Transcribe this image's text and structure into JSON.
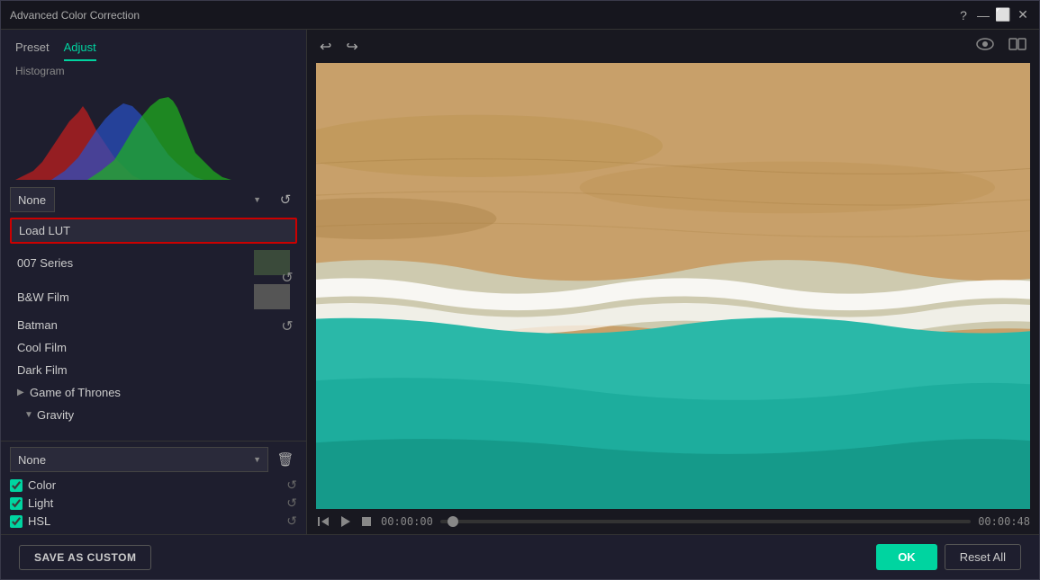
{
  "window": {
    "title": "Advanced Color Correction"
  },
  "tabs": [
    {
      "id": "preset",
      "label": "Preset",
      "active": false
    },
    {
      "id": "adjust",
      "label": "Adjust",
      "active": true
    }
  ],
  "toolbar": {
    "undo_icon": "↩",
    "redo_icon": "↪",
    "eye_icon": "👁",
    "image_icon": "🖼"
  },
  "histogram": {
    "label": "Histogram"
  },
  "preset_dropdown": {
    "value": "None",
    "options": [
      "None"
    ]
  },
  "preset_list": {
    "items": [
      {
        "id": "load-lut",
        "label": "Load LUT",
        "highlighted": true,
        "has_arrow": false,
        "has_thumb": false
      },
      {
        "id": "007-series",
        "label": "007 Series",
        "highlighted": false,
        "has_arrow": false,
        "has_thumb": true
      },
      {
        "id": "bw-film",
        "label": "B&W Film",
        "highlighted": false,
        "has_arrow": false,
        "has_thumb": true
      },
      {
        "id": "batman",
        "label": "Batman",
        "highlighted": false,
        "has_arrow": false,
        "has_thumb": false
      },
      {
        "id": "cool-film",
        "label": "Cool Film",
        "highlighted": false,
        "has_arrow": false,
        "has_thumb": false
      },
      {
        "id": "dark-film",
        "label": "Dark Film",
        "highlighted": false,
        "has_arrow": false,
        "has_thumb": false
      },
      {
        "id": "game-of-thrones",
        "label": "Game of Thrones",
        "highlighted": false,
        "has_arrow": true,
        "has_thumb": false
      },
      {
        "id": "gravity",
        "label": "Gravity",
        "highlighted": false,
        "has_arrow": false,
        "has_thumb": false
      }
    ]
  },
  "none_select": {
    "value": "None",
    "options": [
      "None"
    ]
  },
  "adjustments": [
    {
      "id": "color",
      "label": "Color",
      "checked": true
    },
    {
      "id": "light",
      "label": "Light",
      "checked": true
    },
    {
      "id": "hsl",
      "label": "HSL",
      "checked": true
    }
  ],
  "video": {
    "time_current": "00:00:00",
    "time_total": "00:00:48"
  },
  "buttons": {
    "save_as_custom": "SAVE AS CUSTOM",
    "ok": "OK",
    "reset_all": "Reset All"
  },
  "colors": {
    "accent": "#00d4a0",
    "highlight_border": "#cc0000",
    "active_tab": "#00d4a0"
  }
}
